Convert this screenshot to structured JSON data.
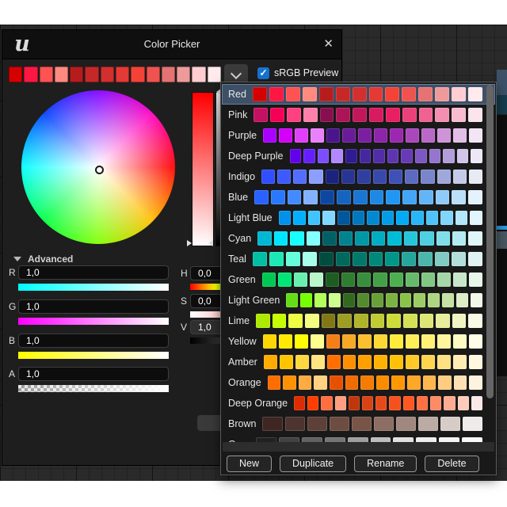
{
  "window": {
    "title": "Color Picker",
    "close_glyph": "✕",
    "logo_glyph": "u"
  },
  "srgb": {
    "label": "sRGB Preview",
    "checked": true,
    "check_glyph": "✓",
    "accent": "#1673d2"
  },
  "advanced": {
    "label": "Advanced",
    "expanded": true
  },
  "sliders": {
    "rgba": [
      {
        "label": "R",
        "value": "1,0",
        "grad": [
          "#00ffff",
          "#ffffff"
        ]
      },
      {
        "label": "G",
        "value": "1,0",
        "grad": [
          "#ff00ff",
          "#ffffff"
        ]
      },
      {
        "label": "B",
        "value": "1,0",
        "grad": [
          "#ffff00",
          "#ffffff"
        ]
      },
      {
        "label": "A",
        "value": "1,0",
        "grad": "alpha-checker"
      }
    ],
    "hsv": [
      {
        "label": "H",
        "value": "0,0",
        "grad": [
          "#ff0000",
          "#ffff00",
          "#00ff00",
          "#00ffff",
          "#0000ff",
          "#ff00ff",
          "#ff0000"
        ]
      },
      {
        "label": "S",
        "value": "0,0",
        "grad": [
          "#ffffff",
          "#ff0000"
        ]
      },
      {
        "label": "V",
        "value": "1,0",
        "grad": [
          "#000000",
          "#ffffff"
        ]
      }
    ]
  },
  "wheel": {
    "type": "hsv-wheel",
    "cursor": "center",
    "sat_bar": [
      "#ff0000",
      "#ffffff"
    ],
    "val_bar": [
      "#ffffff",
      "#000000"
    ]
  },
  "theme_bar": {
    "colors": [
      "#D50000",
      "#FF1744",
      "#FF5252",
      "#FF8A80",
      "#B71C1C",
      "#C62828",
      "#D32F2F",
      "#E53935",
      "#F44336",
      "#EF5350",
      "#E57373",
      "#EF9A9A",
      "#FFCDD2",
      "#FFEBEE"
    ]
  },
  "palette": {
    "selected_row": "Red",
    "rows": [
      {
        "name": "Red",
        "selected": true,
        "colors": [
          "#D50000",
          "#FF1744",
          "#FF5252",
          "#FF8A80",
          "#B71C1C",
          "#C62828",
          "#D32F2F",
          "#E53935",
          "#F44336",
          "#EF5350",
          "#E57373",
          "#EF9A9A",
          "#FFCDD2",
          "#FFEBEE"
        ]
      },
      {
        "name": "Pink",
        "selected": false,
        "colors": [
          "#C51162",
          "#F50057",
          "#FF4081",
          "#FF80AB",
          "#880E4F",
          "#AD1457",
          "#C2185B",
          "#D81B60",
          "#E91E63",
          "#EC407A",
          "#F06292",
          "#F48FB1",
          "#F8BBD0",
          "#FCE4EC"
        ]
      },
      {
        "name": "Purple",
        "selected": false,
        "colors": [
          "#AA00FF",
          "#D500F9",
          "#E040FB",
          "#EA80FC",
          "#4A148C",
          "#6A1B9A",
          "#7B1FA2",
          "#8E24AA",
          "#9C27B0",
          "#AB47BC",
          "#BA68C8",
          "#CE93D8",
          "#E1BEE7",
          "#F3E5F5"
        ]
      },
      {
        "name": "Deep Purple",
        "selected": false,
        "colors": [
          "#6200EA",
          "#651FFF",
          "#7C4DFF",
          "#B388FF",
          "#311B92",
          "#4527A0",
          "#512DA8",
          "#5E35B1",
          "#673AB7",
          "#7E57C2",
          "#9575CD",
          "#B39DDB",
          "#D1C4E9",
          "#EDE7F6"
        ]
      },
      {
        "name": "Indigo",
        "selected": false,
        "colors": [
          "#304FFE",
          "#3D5AFE",
          "#536DFE",
          "#8C9EFF",
          "#1A237E",
          "#283593",
          "#303F9F",
          "#3949AB",
          "#3F51B5",
          "#5C6BC0",
          "#7986CB",
          "#9FA8DA",
          "#C5CAE9",
          "#E8EAF6"
        ]
      },
      {
        "name": "Blue",
        "selected": false,
        "colors": [
          "#2962FF",
          "#2979FF",
          "#448AFF",
          "#82B1FF",
          "#0D47A1",
          "#1565C0",
          "#1976D2",
          "#1E88E5",
          "#2196F3",
          "#42A5F5",
          "#64B5F6",
          "#90CAF9",
          "#BBDEFB",
          "#E3F2FD"
        ]
      },
      {
        "name": "Light Blue",
        "selected": false,
        "colors": [
          "#0091EA",
          "#00B0FF",
          "#40C4FF",
          "#80D8FF",
          "#01579B",
          "#0277BD",
          "#0288D1",
          "#039BE5",
          "#03A9F4",
          "#29B6F6",
          "#4FC3F7",
          "#81D4FA",
          "#B3E5FC",
          "#E1F5FE"
        ]
      },
      {
        "name": "Cyan",
        "selected": false,
        "colors": [
          "#00B8D4",
          "#00E5FF",
          "#18FFFF",
          "#84FFFF",
          "#006064",
          "#00838F",
          "#0097A7",
          "#00ACC1",
          "#00BCD4",
          "#26C6DA",
          "#4DD0E1",
          "#80DEEA",
          "#B2EBF2",
          "#E0F7FA"
        ]
      },
      {
        "name": "Teal",
        "selected": false,
        "colors": [
          "#00BFA5",
          "#1DE9B6",
          "#64FFDA",
          "#A7FFEB",
          "#004D40",
          "#00695C",
          "#00796B",
          "#00897B",
          "#009688",
          "#26A69A",
          "#4DB6AC",
          "#80CBC4",
          "#B2DFDB",
          "#E0F2F1"
        ]
      },
      {
        "name": "Green",
        "selected": false,
        "colors": [
          "#00C853",
          "#00E676",
          "#69F0AE",
          "#B9F6CA",
          "#1B5E20",
          "#2E7D32",
          "#388E3C",
          "#43A047",
          "#4CAF50",
          "#66BB6A",
          "#81C784",
          "#A5D6A7",
          "#C8E6C9",
          "#E8F5E9"
        ]
      },
      {
        "name": "Light Green",
        "selected": false,
        "colors": [
          "#64DD17",
          "#76FF03",
          "#B2FF59",
          "#CCFF90",
          "#33691E",
          "#558B2F",
          "#689F38",
          "#7CB342",
          "#8BC34A",
          "#9CCC65",
          "#AED581",
          "#C5E1A5",
          "#DCEDC8",
          "#F1F8E9"
        ]
      },
      {
        "name": "Lime",
        "selected": false,
        "colors": [
          "#AEEA00",
          "#C6FF00",
          "#EEFF41",
          "#F4FF81",
          "#827717",
          "#9E9D24",
          "#AFB42B",
          "#C0CA33",
          "#CDDC39",
          "#D4E157",
          "#DCE775",
          "#E6EE9C",
          "#F0F4C3",
          "#F9FBE7"
        ]
      },
      {
        "name": "Yellow",
        "selected": false,
        "colors": [
          "#FFD600",
          "#FFEA00",
          "#FFFF00",
          "#FFFF8D",
          "#F57F17",
          "#F9A825",
          "#FBC02D",
          "#FDD835",
          "#FFEB3B",
          "#FFEE58",
          "#FFF176",
          "#FFF59D",
          "#FFF9C4",
          "#FFFDE7"
        ]
      },
      {
        "name": "Amber",
        "selected": false,
        "colors": [
          "#FFAB00",
          "#FFC400",
          "#FFD740",
          "#FFE57F",
          "#FF6F00",
          "#FF8F00",
          "#FFA000",
          "#FFB300",
          "#FFC107",
          "#FFCA28",
          "#FFD54F",
          "#FFE082",
          "#FFECB3",
          "#FFF8E1"
        ]
      },
      {
        "name": "Orange",
        "selected": false,
        "colors": [
          "#FF6D00",
          "#FF9100",
          "#FFAB40",
          "#FFD180",
          "#E65100",
          "#EF6C00",
          "#F57C00",
          "#FB8C00",
          "#FF9800",
          "#FFA726",
          "#FFB74D",
          "#FFCC80",
          "#FFE0B2",
          "#FFF3E0"
        ]
      },
      {
        "name": "Deep Orange",
        "selected": false,
        "colors": [
          "#DD2C00",
          "#FF3D00",
          "#FF6E40",
          "#FF9E80",
          "#BF360C",
          "#D84315",
          "#E64A19",
          "#F4511E",
          "#FF5722",
          "#FF7043",
          "#FF8A65",
          "#FFAB91",
          "#FFCCBC",
          "#FBE9E7"
        ]
      },
      {
        "name": "Brown",
        "selected": false,
        "colors": [
          "#3E2723",
          "#4E342E",
          "#5D4037",
          "#6D4C41",
          "#795548",
          "#8D6E63",
          "#A1887F",
          "#BCAAA4",
          "#D7CCC8",
          "#EFEBE9"
        ]
      },
      {
        "name": "Grey",
        "selected": false,
        "colors": [
          "#212121",
          "#424242",
          "#616161",
          "#757575",
          "#9E9E9E",
          "#BDBDBD",
          "#E0E0E0",
          "#EEEEEE",
          "#F5F5F5",
          "#FAFAFA"
        ]
      }
    ]
  },
  "panel_buttons": [
    {
      "label": "New"
    },
    {
      "label": "Duplicate"
    },
    {
      "label": "Rename"
    },
    {
      "label": "Delete"
    }
  ]
}
